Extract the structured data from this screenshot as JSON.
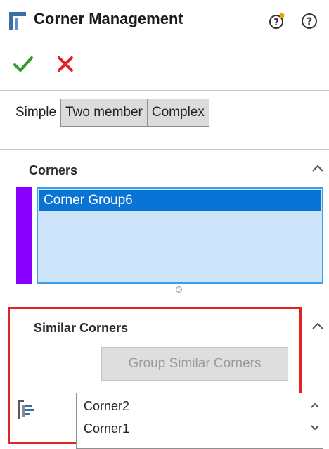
{
  "header": {
    "title": "Corner Management",
    "icons": {
      "feature": "corner-management-icon",
      "whats_new": "whats-new-help-icon",
      "help": "help-icon"
    },
    "ok": "checkmark-icon",
    "cancel": "cross-icon"
  },
  "tabs": [
    {
      "label": "Simple",
      "active": true
    },
    {
      "label": "Two member",
      "active": false
    },
    {
      "label": "Complex",
      "active": false
    }
  ],
  "corners": {
    "title": "Corners",
    "items": [
      {
        "label": "Corner Group6",
        "selected": true
      }
    ],
    "group_color": "#8a00ff"
  },
  "similar_corners": {
    "title": "Similar Corners",
    "button": "Group Similar Corners",
    "items": [
      "Corner2",
      "Corner1"
    ]
  },
  "colors": {
    "accent": "#0a74d6",
    "ok": "#2e9a2e",
    "cancel": "#e02424",
    "highlight_frame": "#e02424"
  }
}
